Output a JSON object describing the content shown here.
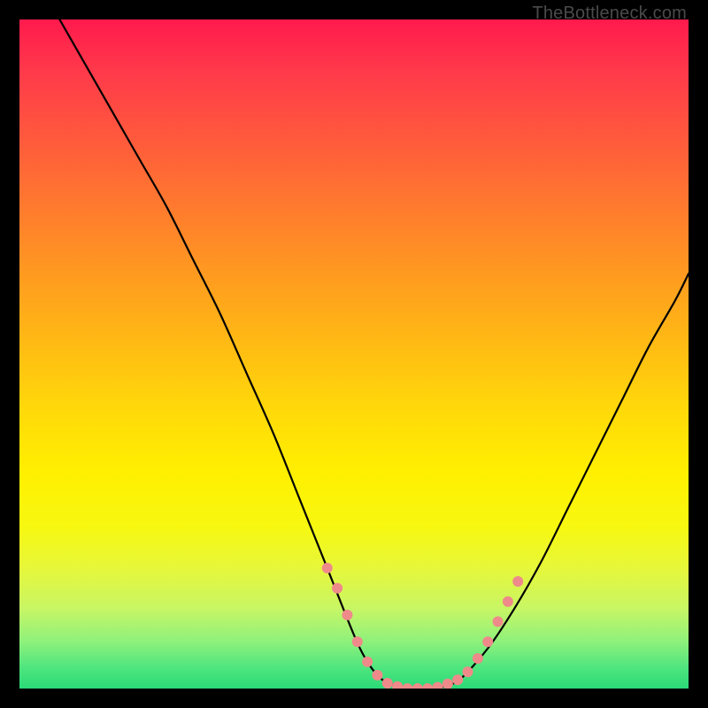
{
  "watermark": "TheBottleneck.com",
  "chart_data": {
    "type": "line",
    "title": "",
    "xlabel": "",
    "ylabel": "",
    "xlim": [
      0,
      100
    ],
    "ylim": [
      0,
      100
    ],
    "series": [
      {
        "name": "bottleneck-curve",
        "x": [
          6,
          10,
          14,
          18,
          22,
          26,
          30,
          34,
          38,
          42,
          46,
          50,
          52,
          54,
          56,
          58,
          60,
          62,
          64,
          66,
          70,
          74,
          78,
          82,
          86,
          90,
          94,
          98,
          100
        ],
        "y": [
          100,
          93,
          86,
          79,
          72,
          64,
          56,
          47,
          38,
          28,
          18,
          8,
          4,
          1.5,
          0.5,
          0,
          0,
          0,
          0.5,
          1.5,
          6,
          12,
          19,
          27,
          35,
          43,
          51,
          58,
          62
        ]
      }
    ],
    "markers": {
      "name": "highlight-dots",
      "color": "#ef8a8a",
      "points": [
        {
          "x": 46,
          "y": 18
        },
        {
          "x": 47.5,
          "y": 15
        },
        {
          "x": 49,
          "y": 11
        },
        {
          "x": 50.5,
          "y": 7
        },
        {
          "x": 52,
          "y": 4
        },
        {
          "x": 53.5,
          "y": 2
        },
        {
          "x": 55,
          "y": 0.8
        },
        {
          "x": 56.5,
          "y": 0.3
        },
        {
          "x": 58,
          "y": 0
        },
        {
          "x": 59.5,
          "y": 0
        },
        {
          "x": 61,
          "y": 0
        },
        {
          "x": 62.5,
          "y": 0.2
        },
        {
          "x": 64,
          "y": 0.7
        },
        {
          "x": 65.5,
          "y": 1.3
        },
        {
          "x": 67,
          "y": 2.5
        },
        {
          "x": 68.5,
          "y": 4.5
        },
        {
          "x": 70,
          "y": 7
        },
        {
          "x": 71.5,
          "y": 10
        },
        {
          "x": 73,
          "y": 13
        },
        {
          "x": 74.5,
          "y": 16
        }
      ]
    }
  }
}
